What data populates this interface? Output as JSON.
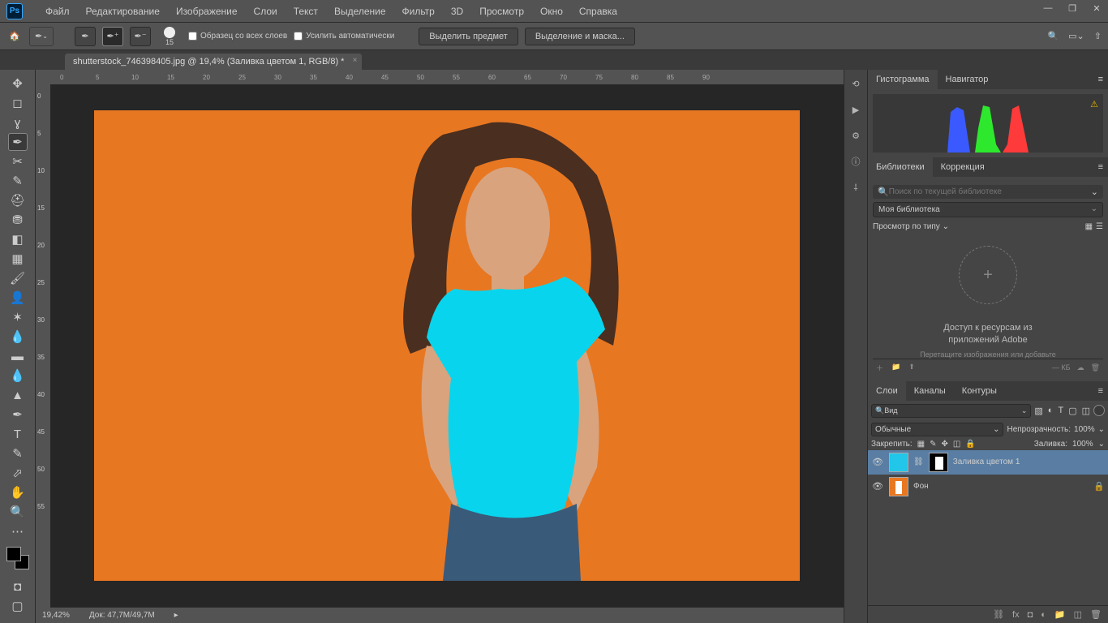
{
  "menu": [
    "Файл",
    "Редактирование",
    "Изображение",
    "Слои",
    "Текст",
    "Выделение",
    "Фильтр",
    "3D",
    "Просмотр",
    "Окно",
    "Справка"
  ],
  "options": {
    "brush_size": "15",
    "sample_all": "Образец со всех слоев",
    "auto_enhance": "Усилить автоматически",
    "select_subject": "Выделить предмет",
    "select_and_mask": "Выделение и маска..."
  },
  "doc_tab": "shutterstock_746398405.jpg @ 19,4% (Заливка цветом 1, RGB/8) *",
  "ruler_h": [
    "0",
    "5",
    "10",
    "15",
    "20",
    "25",
    "30",
    "35",
    "40",
    "45",
    "50",
    "55",
    "60",
    "65",
    "70",
    "75",
    "80",
    "85",
    "90"
  ],
  "ruler_v": [
    "0",
    "5",
    "10",
    "15",
    "20",
    "25",
    "30",
    "35",
    "40",
    "45",
    "50",
    "55"
  ],
  "status": {
    "zoom": "19,42%",
    "doc": "Док: 47,7M/49,7M"
  },
  "panels": {
    "histogram_tabs": [
      "Гистограмма",
      "Навигатор"
    ],
    "lib_tabs": [
      "Библиотеки",
      "Коррекция"
    ],
    "lib_search_placeholder": "Поиск по текущей библиотеке",
    "lib_select": "Моя библиотека",
    "lib_view": "Просмотр по типу",
    "lib_access1": "Доступ к ресурсам из",
    "lib_access2": "приложений Adobe",
    "lib_hint": "Перетащите изображения или добавьте",
    "lib_kb": "— КБ",
    "layers_tabs": [
      "Слои",
      "Каналы",
      "Контуры"
    ],
    "layers_kind": "Вид",
    "blend_mode": "Обычные",
    "opacity_label": "Непрозрачность:",
    "opacity_val": "100%",
    "lock_label": "Закрепить:",
    "fill_label": "Заливка:",
    "fill_val": "100%",
    "layer1": "Заливка цветом 1",
    "layer2": "Фон"
  }
}
